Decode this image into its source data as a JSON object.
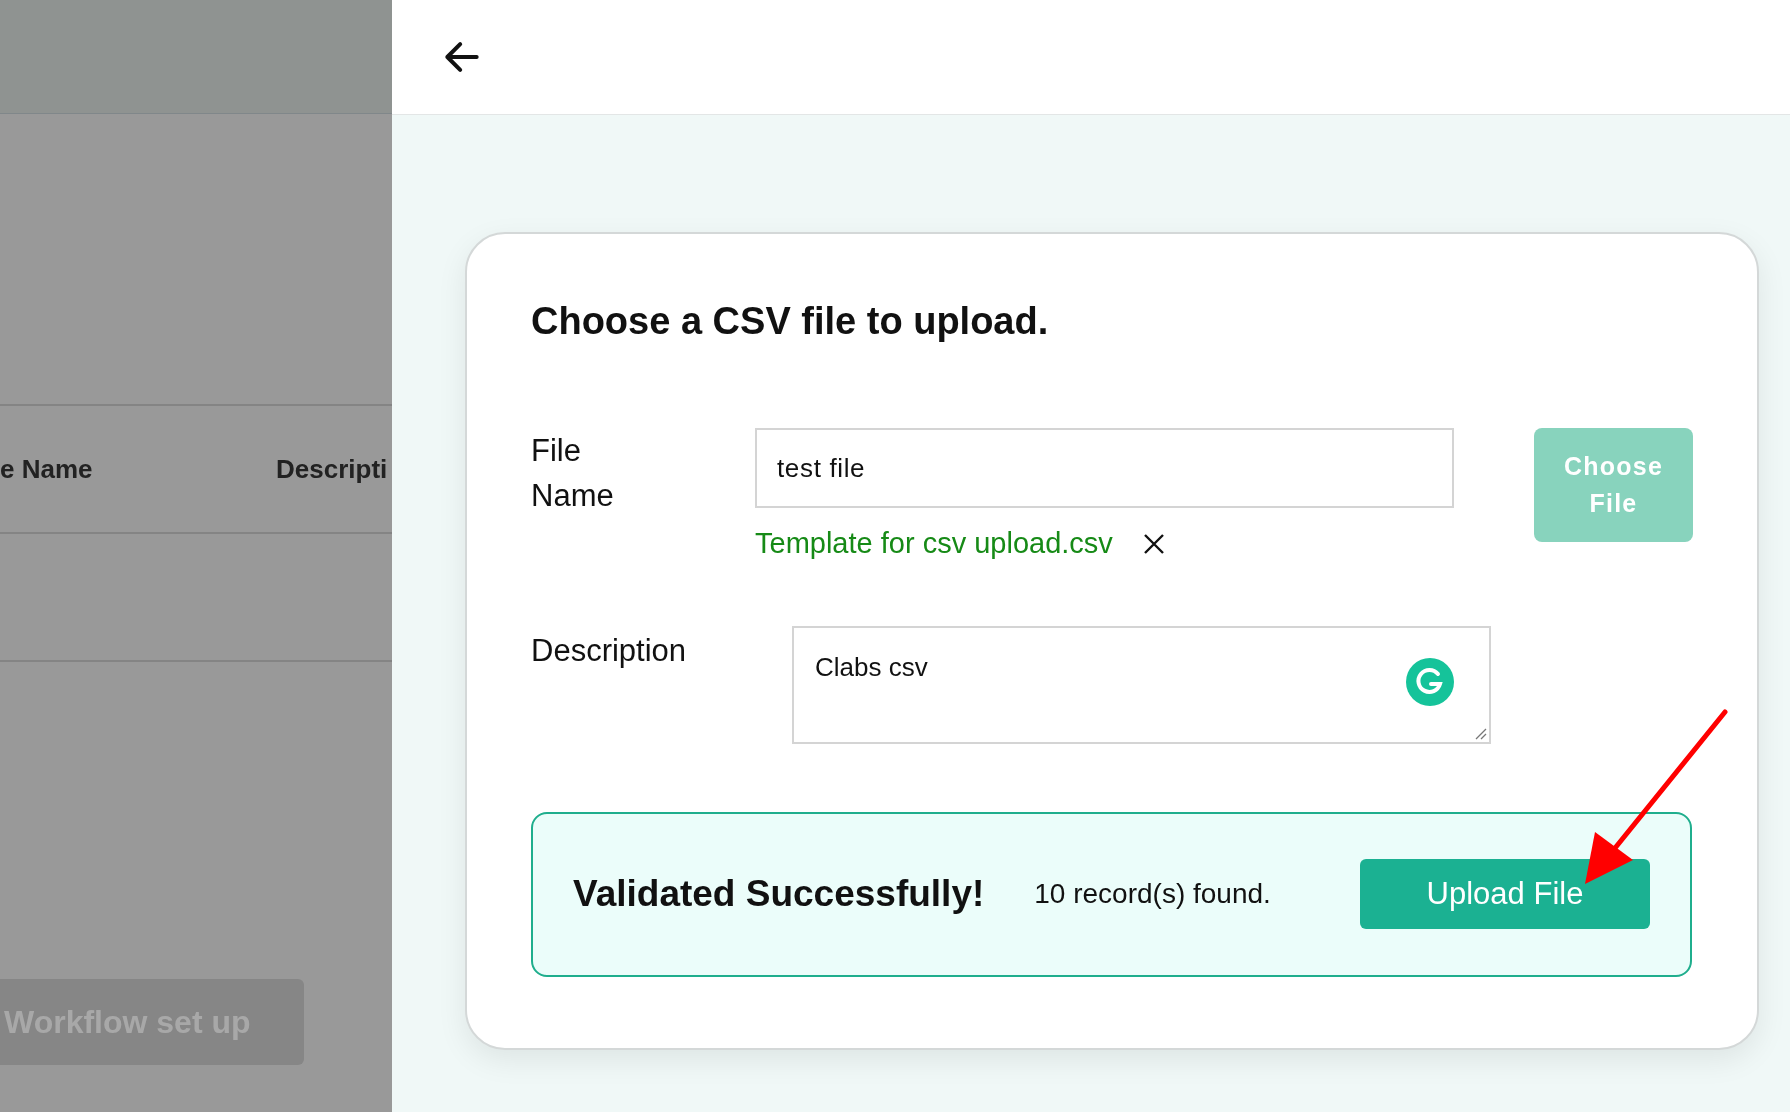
{
  "background_page": {
    "table_columns": [
      "e Name",
      "Descripti"
    ],
    "workflow_button": "Workflow set up"
  },
  "upload_card": {
    "title": "Choose a CSV file to upload.",
    "file_name": {
      "label": "File Name",
      "value": "test file"
    },
    "choose_button": {
      "label": "Choose File",
      "disabled": true
    },
    "selected_file": {
      "name": "Template for csv upload.csv"
    },
    "description": {
      "label": "Description",
      "value": "Clabs csv"
    },
    "validation": {
      "title": "Validated Successfully!",
      "message": "10 record(s) found.",
      "button": "Upload File"
    }
  }
}
